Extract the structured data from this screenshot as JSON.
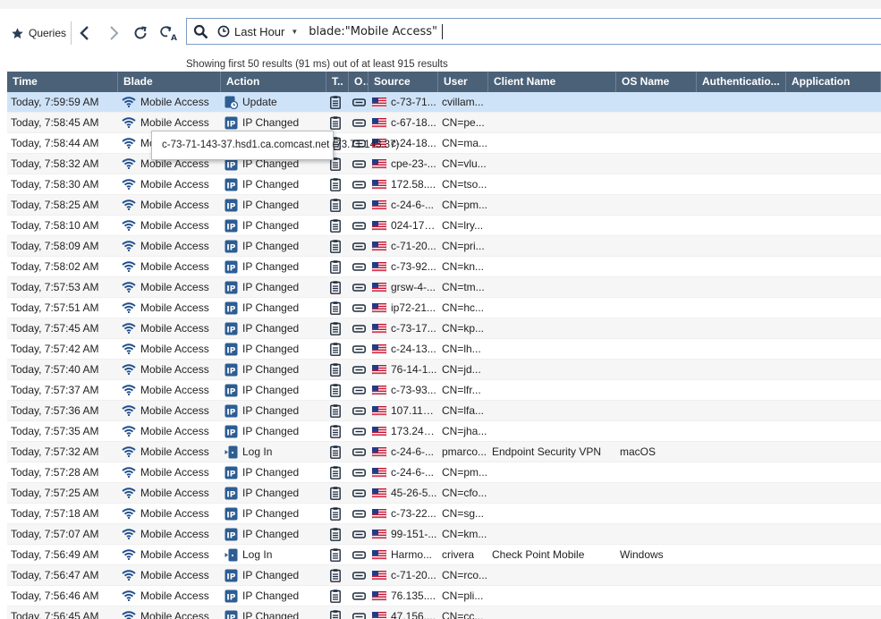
{
  "toolbar": {
    "queries_label": "Queries",
    "time_range": "Last Hour",
    "query": "blade:\"Mobile Access\"",
    "status": "Showing first 50 results (91 ms) out of at least 915 results"
  },
  "columns": [
    "Time",
    "Blade",
    "Action",
    "T..",
    "O..",
    "Source",
    "User",
    "Client Name",
    "OS Name",
    "Authenticatio...",
    "Application"
  ],
  "tooltip": "c-73-71-143-37.hsd1.ca.comcast.net (73.71.143.37)",
  "icons": {
    "blade": "wifi-icon",
    "action_update": "update-icon",
    "action_ip": "ip-changed-icon",
    "action_login": "log-in-icon",
    "type": "log-document-icon",
    "origin": "gateway-icon",
    "source": "us-flag-icon"
  },
  "colors": {
    "header_bg": "#4a6178",
    "selected_row": "#cfe3f8",
    "icon_blue": "#1f4e8c"
  },
  "rows": [
    {
      "time": "Today, 7:59:59 AM",
      "blade": "Mobile Access",
      "action": "Update",
      "action_type": "update",
      "source": "c-73-71...",
      "user": "cvillam...",
      "client": "",
      "os": ""
    },
    {
      "time": "Today, 7:58:45 AM",
      "blade": "Mobile Access",
      "action": "IP Changed",
      "action_type": "ip",
      "source": "c-67-18...",
      "user": "CN=pe...",
      "client": "",
      "os": ""
    },
    {
      "time": "Today, 7:58:44 AM",
      "blade": "Mobile Access",
      "action": "IP Changed",
      "action_type": "ip",
      "source": "c-24-18...",
      "user": "CN=ma...",
      "client": "",
      "os": ""
    },
    {
      "time": "Today, 7:58:32 AM",
      "blade": "Mobile Access",
      "action": "IP Changed",
      "action_type": "ip",
      "source": "cpe-23-...",
      "user": "CN=vlu...",
      "client": "",
      "os": ""
    },
    {
      "time": "Today, 7:58:30 AM",
      "blade": "Mobile Access",
      "action": "IP Changed",
      "action_type": "ip",
      "source": "172.58....",
      "user": "CN=tso...",
      "client": "",
      "os": ""
    },
    {
      "time": "Today, 7:58:25 AM",
      "blade": "Mobile Access",
      "action": "IP Changed",
      "action_type": "ip",
      "source": "c-24-6-...",
      "user": "CN=pm...",
      "client": "",
      "os": ""
    },
    {
      "time": "Today, 7:58:10 AM",
      "blade": "Mobile Access",
      "action": "IP Changed",
      "action_type": "ip",
      "source": "024-178...",
      "user": "CN=lry...",
      "client": "",
      "os": ""
    },
    {
      "time": "Today, 7:58:09 AM",
      "blade": "Mobile Access",
      "action": "IP Changed",
      "action_type": "ip",
      "source": "c-71-20...",
      "user": "CN=pri...",
      "client": "",
      "os": ""
    },
    {
      "time": "Today, 7:58:02 AM",
      "blade": "Mobile Access",
      "action": "IP Changed",
      "action_type": "ip",
      "source": "c-73-92...",
      "user": "CN=kn...",
      "client": "",
      "os": ""
    },
    {
      "time": "Today, 7:57:53 AM",
      "blade": "Mobile Access",
      "action": "IP Changed",
      "action_type": "ip",
      "source": "grsw-4-...",
      "user": "CN=tm...",
      "client": "",
      "os": ""
    },
    {
      "time": "Today, 7:57:51 AM",
      "blade": "Mobile Access",
      "action": "IP Changed",
      "action_type": "ip",
      "source": "ip72-21...",
      "user": "CN=hc...",
      "client": "",
      "os": ""
    },
    {
      "time": "Today, 7:57:45 AM",
      "blade": "Mobile Access",
      "action": "IP Changed",
      "action_type": "ip",
      "source": "c-73-17...",
      "user": "CN=kp...",
      "client": "",
      "os": ""
    },
    {
      "time": "Today, 7:57:42 AM",
      "blade": "Mobile Access",
      "action": "IP Changed",
      "action_type": "ip",
      "source": "c-24-13...",
      "user": "CN=lh...",
      "client": "",
      "os": ""
    },
    {
      "time": "Today, 7:57:40 AM",
      "blade": "Mobile Access",
      "action": "IP Changed",
      "action_type": "ip",
      "source": "76-14-1...",
      "user": "CN=jd...",
      "client": "",
      "os": ""
    },
    {
      "time": "Today, 7:57:37 AM",
      "blade": "Mobile Access",
      "action": "IP Changed",
      "action_type": "ip",
      "source": "c-73-93...",
      "user": "CN=lfr...",
      "client": "",
      "os": ""
    },
    {
      "time": "Today, 7:57:36 AM",
      "blade": "Mobile Access",
      "action": "IP Changed",
      "action_type": "ip",
      "source": "107.116....",
      "user": "CN=lfa...",
      "client": "",
      "os": ""
    },
    {
      "time": "Today, 7:57:35 AM",
      "blade": "Mobile Access",
      "action": "IP Changed",
      "action_type": "ip",
      "source": "173.245....",
      "user": "CN=jha...",
      "client": "",
      "os": ""
    },
    {
      "time": "Today, 7:57:32 AM",
      "blade": "Mobile Access",
      "action": "Log In",
      "action_type": "login",
      "source": "c-24-6-...",
      "user": "pmarco...",
      "client": "Endpoint Security VPN",
      "os": "macOS"
    },
    {
      "time": "Today, 7:57:28 AM",
      "blade": "Mobile Access",
      "action": "IP Changed",
      "action_type": "ip",
      "source": "c-24-6-...",
      "user": "CN=pm...",
      "client": "",
      "os": ""
    },
    {
      "time": "Today, 7:57:25 AM",
      "blade": "Mobile Access",
      "action": "IP Changed",
      "action_type": "ip",
      "source": "45-26-5...",
      "user": "CN=cfo...",
      "client": "",
      "os": ""
    },
    {
      "time": "Today, 7:57:18 AM",
      "blade": "Mobile Access",
      "action": "IP Changed",
      "action_type": "ip",
      "source": "c-73-22...",
      "user": "CN=sg...",
      "client": "",
      "os": ""
    },
    {
      "time": "Today, 7:57:07 AM",
      "blade": "Mobile Access",
      "action": "IP Changed",
      "action_type": "ip",
      "source": "99-151-...",
      "user": "CN=km...",
      "client": "",
      "os": ""
    },
    {
      "time": "Today, 7:56:49 AM",
      "blade": "Mobile Access",
      "action": "Log In",
      "action_type": "login",
      "source": "Harmo...",
      "user": "crivera",
      "client": "Check Point Mobile",
      "os": "Windows"
    },
    {
      "time": "Today, 7:56:47 AM",
      "blade": "Mobile Access",
      "action": "IP Changed",
      "action_type": "ip",
      "source": "c-71-20...",
      "user": "CN=rco...",
      "client": "",
      "os": ""
    },
    {
      "time": "Today, 7:56:46 AM",
      "blade": "Mobile Access",
      "action": "IP Changed",
      "action_type": "ip",
      "source": "76.135....",
      "user": "CN=pli...",
      "client": "",
      "os": ""
    },
    {
      "time": "Today, 7:56:45 AM",
      "blade": "Mobile Access",
      "action": "IP Changed",
      "action_type": "ip",
      "source": "47.156....",
      "user": "CN=cc...",
      "client": "",
      "os": ""
    }
  ]
}
